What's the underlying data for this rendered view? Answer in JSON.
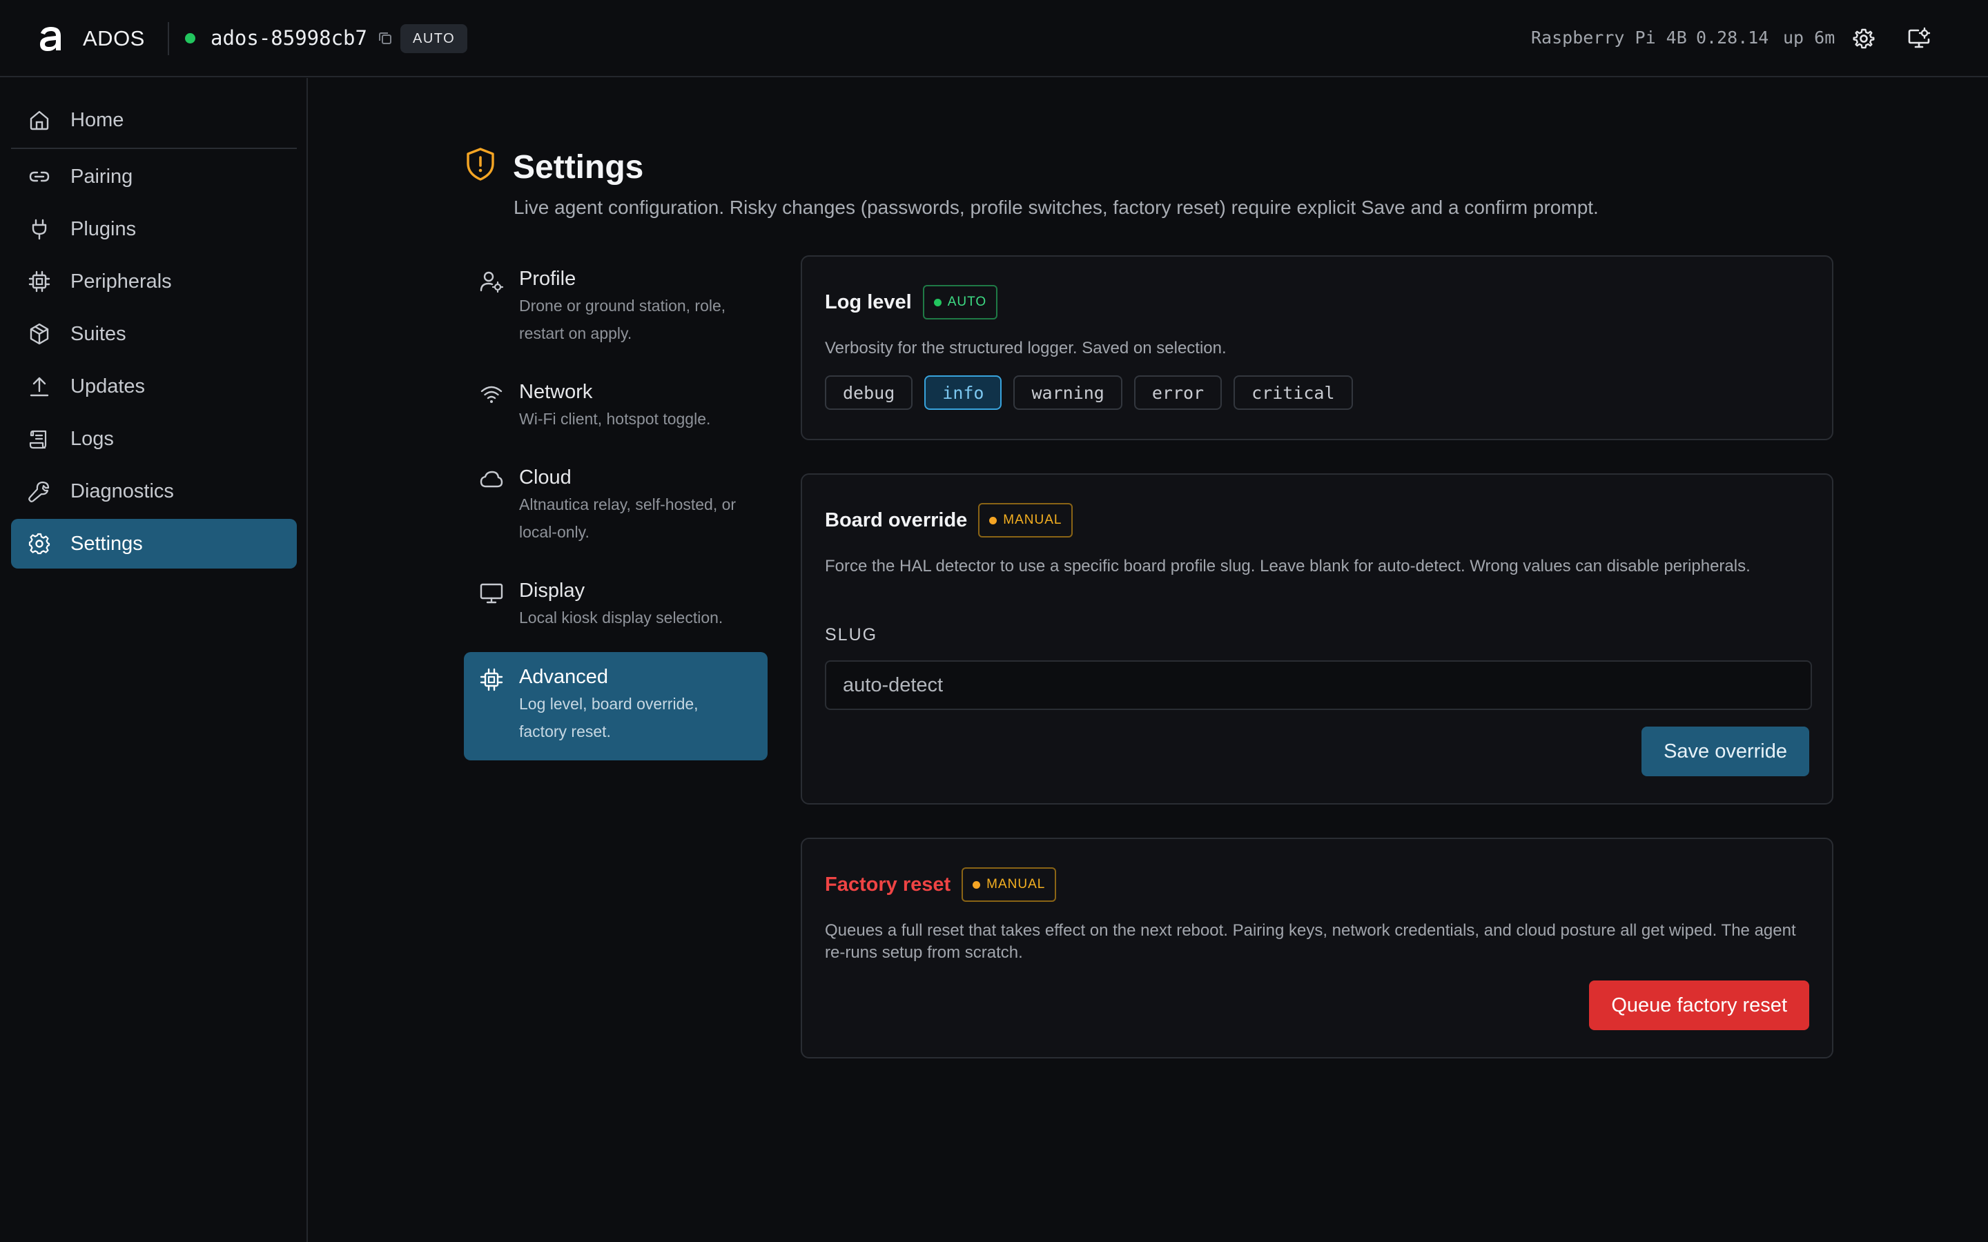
{
  "app": {
    "name": "ADOS",
    "agent_id": "ados-85998cb7",
    "mode": "AUTO",
    "device": "Raspberry Pi 4B",
    "version": "0.28.14",
    "uptime": "up 6m"
  },
  "sidebar": {
    "items": [
      {
        "label": "Home",
        "icon": "home-icon"
      },
      {
        "label": "Pairing",
        "icon": "link-icon"
      },
      {
        "label": "Plugins",
        "icon": "plug-icon"
      },
      {
        "label": "Peripherals",
        "icon": "chip-icon"
      },
      {
        "label": "Suites",
        "icon": "box-icon"
      },
      {
        "label": "Updates",
        "icon": "upload-icon"
      },
      {
        "label": "Logs",
        "icon": "scroll-icon"
      },
      {
        "label": "Diagnostics",
        "icon": "wrench-icon"
      },
      {
        "label": "Settings",
        "icon": "gear-icon"
      }
    ],
    "active": "Settings"
  },
  "page": {
    "title": "Settings",
    "subtitle": "Live agent configuration. Risky changes (passwords, profile switches, factory reset) require explicit Save and a confirm prompt."
  },
  "subnav": [
    {
      "title": "Profile",
      "desc1": "Drone or ground station, role,",
      "desc2": "restart on apply.",
      "icon": "user-gear-icon"
    },
    {
      "title": "Network",
      "desc1": "Wi-Fi client, hotspot toggle.",
      "desc2": "",
      "icon": "wifi-icon"
    },
    {
      "title": "Cloud",
      "desc1": "Altnautica relay, self-hosted, or",
      "desc2": "local-only.",
      "icon": "cloud-icon"
    },
    {
      "title": "Display",
      "desc1": "Local kiosk display selection.",
      "desc2": "",
      "icon": "monitor-icon"
    },
    {
      "title": "Advanced",
      "desc1": "Log level, board override,",
      "desc2": "factory reset.",
      "icon": "chip-icon"
    }
  ],
  "log_level": {
    "title": "Log level",
    "badge": "AUTO",
    "desc": "Verbosity for the structured logger. Saved on selection.",
    "options": [
      "debug",
      "info",
      "warning",
      "error",
      "critical"
    ],
    "selected": "info"
  },
  "board_override": {
    "title": "Board override",
    "badge": "MANUAL",
    "desc": "Force the HAL detector to use a specific board profile slug. Leave blank for auto-detect. Wrong values can disable peripherals.",
    "field_label": "SLUG",
    "placeholder": "auto-detect",
    "value": "",
    "save_label": "Save override"
  },
  "factory_reset": {
    "title": "Factory reset",
    "badge": "MANUAL",
    "desc": "Queues a full reset that takes effect on the next reboot. Pairing keys, network credentials, and cloud posture all get wiped. The agent re-runs setup from scratch.",
    "button_label": "Queue factory reset"
  },
  "colors": {
    "accent": "#1f5a7a",
    "success": "#22c55e",
    "warning": "#f5a524",
    "danger": "#dc2f2f",
    "background": "#0c0d10"
  }
}
